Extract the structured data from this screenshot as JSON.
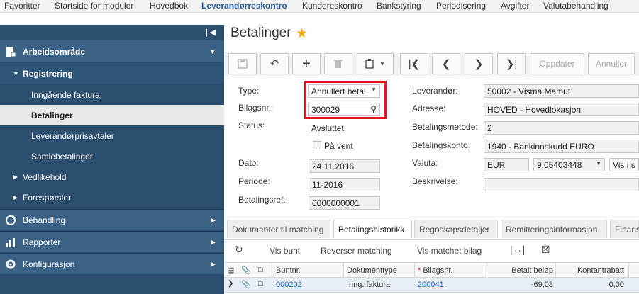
{
  "topnav": {
    "items": [
      {
        "label": "Favoritter"
      },
      {
        "label": "Startside for moduler"
      },
      {
        "label": "Hovedbok"
      },
      {
        "label": "Leverandørreskontro"
      },
      {
        "label": "Kundereskontro"
      },
      {
        "label": "Bankstyring"
      },
      {
        "label": "Periodisering"
      },
      {
        "label": "Avgifter"
      },
      {
        "label": "Valutabehandling"
      }
    ],
    "active_index": 3
  },
  "sidebar": {
    "workspace": "Arbeidsområde",
    "registration": "Registrering",
    "items": [
      "Inngående faktura",
      "Betalinger",
      "Leverandørprisavtaler",
      "Samlebetalinger"
    ],
    "active_item": "Betalinger",
    "maintenance": "Vedlikehold",
    "inquiries": "Forespørsler",
    "processing": "Behandling",
    "reports": "Rapporter",
    "configuration": "Konfigurasjon"
  },
  "page": {
    "title": "Betalinger"
  },
  "toolbar": {
    "update_label": "Oppdater",
    "cancel_label": "Annuller"
  },
  "form": {
    "type_label": "Type:",
    "type_value": "Annullert betal",
    "voucher_label": "Bilagsnr.:",
    "voucher_value": "300029",
    "status_label": "Status:",
    "status_value": "Avsluttet",
    "on_hold_label": "På vent",
    "date_label": "Dato:",
    "date_value": "24.11.2016",
    "period_label": "Periode:",
    "period_value": "11-2016",
    "payref_label": "Betalingsref.:",
    "payref_value": "0000000001",
    "supplier_label": "Leverandør:",
    "supplier_value": "50002 - Visma Mamut",
    "address_label": "Adresse:",
    "address_value": "HOVED - Hovedlokasjon",
    "paymethod_label": "Betalingsmetode:",
    "paymethod_value": "2",
    "payaccount_label": "Betalingskonto:",
    "payaccount_value": "1940 - Bankinnskudd EURO",
    "currency_label": "Valuta:",
    "currency_value": "EUR",
    "rate_value": "9,05403448",
    "show_label": "Vis i s",
    "description_label": "Beskrivelse:"
  },
  "tabs": [
    {
      "label": "Dokumenter til matching"
    },
    {
      "label": "Betalingshistorikk"
    },
    {
      "label": "Regnskapsdetaljer"
    },
    {
      "label": "Remitteringsinformasjon"
    },
    {
      "label": "Finans"
    }
  ],
  "active_tab": "Betalingshistorikk",
  "subtoolbar": {
    "show_batch": "Vis bunt",
    "reverse_matching": "Reverser matching",
    "show_matched": "Vis matchet bilag"
  },
  "grid": {
    "headers": {
      "batch": "Buntnr.",
      "doctype": "Dokumenttype",
      "voucher": "Bilagsnr.",
      "paid": "Betalt beløp",
      "discount": "Kontantrabatt"
    },
    "rows": [
      {
        "batch": "000202",
        "doctype": "Inng. faktura",
        "voucher": "200041",
        "paid": "-69,03",
        "discount": "0,00"
      }
    ]
  }
}
